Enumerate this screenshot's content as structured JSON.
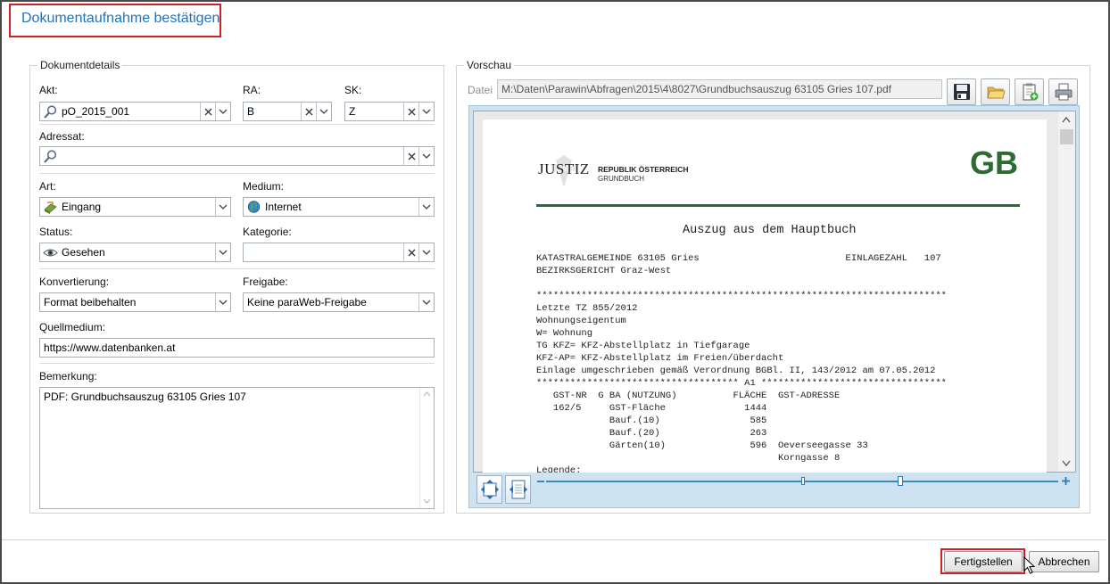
{
  "dialog": {
    "title": "Dokumentaufnahme bestätigen"
  },
  "details": {
    "legend": "Dokumentdetails",
    "akt": {
      "label": "Akt:",
      "value": "pO_2015_001",
      "icon": "search-icon"
    },
    "ra": {
      "label": "RA:",
      "value": "B"
    },
    "sk": {
      "label": "SK:",
      "value": "Z"
    },
    "adressat": {
      "label": "Adressat:",
      "value": "",
      "icon": "search-icon"
    },
    "art": {
      "label": "Art:",
      "value": "Eingang",
      "icon": "incoming-document-icon"
    },
    "medium": {
      "label": "Medium:",
      "value": "Internet",
      "icon": "globe-icon"
    },
    "status": {
      "label": "Status:",
      "value": "Gesehen",
      "icon": "eye-icon"
    },
    "kategorie": {
      "label": "Kategorie:",
      "value": ""
    },
    "konvertierung": {
      "label": "Konvertierung:",
      "value": "Format beibehalten"
    },
    "freigabe": {
      "label": "Freigabe:",
      "value": "Keine paraWeb-Freigabe"
    },
    "quellmedium": {
      "label": "Quellmedium:",
      "value": "https://www.datenbanken.at"
    },
    "bemerkung": {
      "label": "Bemerkung:",
      "value": "PDF: Grundbuchsauszug 63105 Gries 107"
    }
  },
  "preview": {
    "legend": "Vorschau",
    "file_label": "Datei",
    "file_path": "M:\\Daten\\Parawin\\Abfragen\\2015\\4\\8027\\Grundbuchsauszug 63105 Gries 107.pdf",
    "toolbar_icons": [
      "save-disk-icon",
      "open-folder-icon",
      "clipboard-add-icon",
      "print-icon"
    ],
    "document": {
      "logo_text": "JUSTIZ",
      "republic": "REPUBLIK ÖSTERREICH",
      "grundbuch": "GRUNDBUCH",
      "gb": "GB",
      "heading": "Auszug aus dem Hauptbuch",
      "lines": [
        "KATASTRALGEMEINDE 63105 Gries                          EINLAGEZAHL   107",
        "BEZIRKSGERICHT Graz-West",
        "",
        "*************************************************************************",
        "Letzte TZ 855/2012",
        "Wohnungseigentum",
        "W= Wohnung",
        "TG KFZ= KFZ-Abstellplatz in Tiefgarage",
        "KFZ-AP= KFZ-Abstellplatz im Freien/überdacht",
        "Einlage umgeschrieben gemäß Verordnung BGBl. II, 143/2012 am 07.05.2012",
        "************************************ A1 *********************************",
        "   GST-NR  G BA (NUTZUNG)          FLÄCHE  GST-ADRESSE",
        "   162/5     GST-Fläche              1444",
        "             Bauf.(10)                585",
        "             Bauf.(20)                263",
        "             Gärten(10)               596  Oeverseegasse 33",
        "                                           Korngasse 8",
        "Legende:"
      ]
    }
  },
  "footer": {
    "finish": "Fertigstellen",
    "cancel": "Abbrechen"
  }
}
